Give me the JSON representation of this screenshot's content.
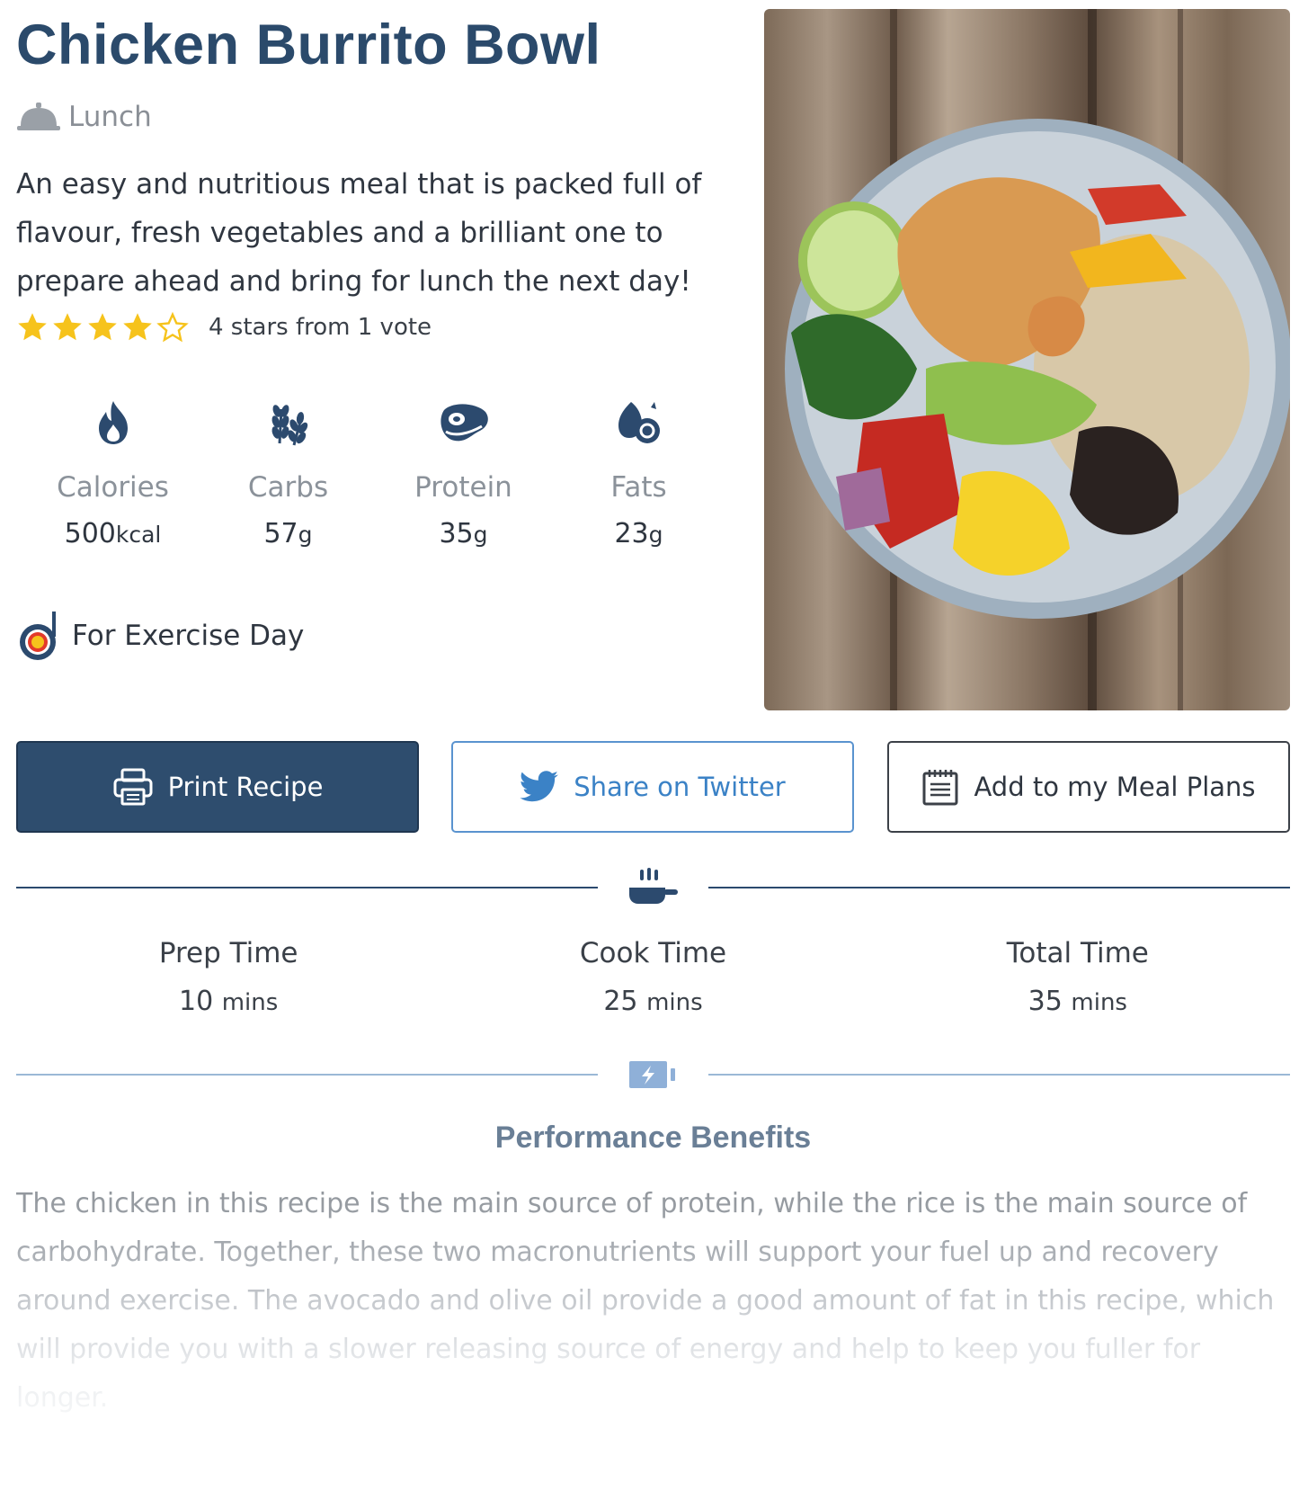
{
  "recipe": {
    "title": "Chicken Burrito Bowl",
    "meal_type": "Lunch",
    "description": "An easy and nutritious meal that is packed full of flavour, fresh vegetables and a brilliant one to prepare ahead and bring for lunch the next day!",
    "rating": {
      "value": 4,
      "max": 5,
      "text": "4 stars from 1 vote"
    },
    "exercise_label": "For Exercise Day"
  },
  "macros": [
    {
      "label": "Calories",
      "value": "500",
      "unit": "kcal",
      "icon": "flame-icon"
    },
    {
      "label": "Carbs",
      "value": "57",
      "unit": "g",
      "icon": "wheat-icon"
    },
    {
      "label": "Protein",
      "value": "35",
      "unit": "g",
      "icon": "steak-icon"
    },
    {
      "label": "Fats",
      "value": "23",
      "unit": "g",
      "icon": "oil-drops-icon"
    }
  ],
  "actions": {
    "print": "Print Recipe",
    "twitter": "Share on Twitter",
    "meal_plan": "Add to my Meal Plans"
  },
  "times": [
    {
      "label": "Prep Time",
      "value": "10",
      "unit": "mins"
    },
    {
      "label": "Cook Time",
      "value": "25",
      "unit": "mins"
    },
    {
      "label": "Total Time",
      "value": "35",
      "unit": "mins"
    }
  ],
  "performance": {
    "title": "Performance Benefits",
    "text": "The chicken in this recipe is the main source of protein, while the rice is the main source of carbohydrate. Together, these two macronutrients will support your fuel up and recovery around exercise. The avocado and olive oil provide a good amount of fat in this recipe, which will provide you with a slower releasing source of energy and help to keep you fuller for longer."
  },
  "colors": {
    "title": "#2b4a6b",
    "primary_button": "#2e4d6e",
    "twitter_blue": "#3b82c6",
    "star": "#f6c31c"
  }
}
